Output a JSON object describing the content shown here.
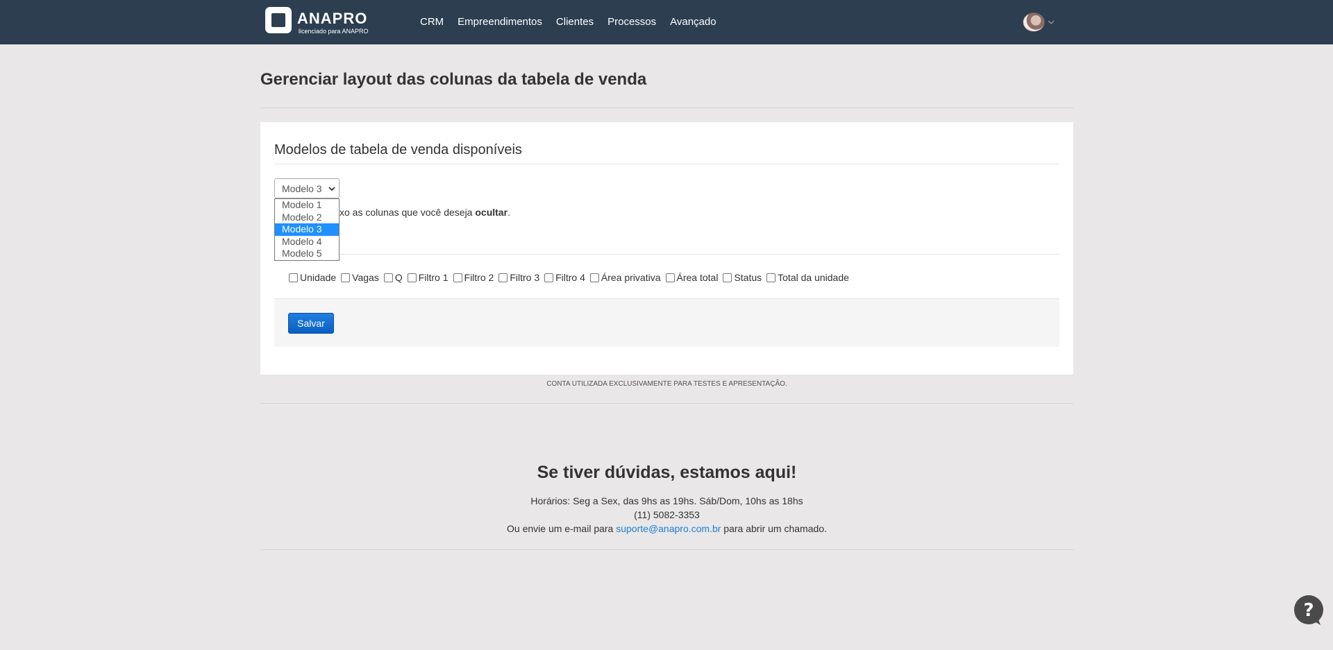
{
  "navbar": {
    "brand_name": "ANAPRO",
    "brand_sub": "licenciado para ANAPRO",
    "menu": [
      "CRM",
      "Empreendimentos",
      "Clientes",
      "Processos",
      "Avançado"
    ]
  },
  "page": {
    "title": "Gerenciar layout das colunas da tabela de venda"
  },
  "card": {
    "title": "Modelos de tabela de venda disponíveis",
    "selected_model": "Modelo 3",
    "model_options": [
      "Modelo 1",
      "Modelo 2",
      "Modelo 3",
      "Modelo 4",
      "Modelo 5"
    ],
    "hint_prefix": "xo as colunas que você deseja ",
    "hint_bold": "ocultar",
    "hint_suffix": ".",
    "columns": [
      "Unidade",
      "Vagas",
      "Q",
      "Filtro 1",
      "Filtro 2",
      "Filtro 3",
      "Filtro 4",
      "Área privativa",
      "Área total",
      "Status",
      "Total da unidade"
    ],
    "save_label": "Salvar"
  },
  "footer": {
    "disclaimer": "CONTA UTILIZADA EXCLUSIVAMENTE PARA TESTES E APRESENTAÇÃO.",
    "help_heading": "Se tiver dúvidas, estamos aqui!",
    "hours": "Horários: Seg a Sex, das 9hs as 19hs. Sáb/Dom, 10hs as 18hs",
    "phone": "(11) 5082-3353",
    "email_prefix": "Ou envie um e-mail para ",
    "email": "suporte@anapro.com.br",
    "email_suffix": " para abrir um chamado."
  },
  "colors": {
    "navbar_bg": "#2c3e50",
    "accent_blue": "#0a5fc4",
    "selected_option": "#1e90ff"
  }
}
